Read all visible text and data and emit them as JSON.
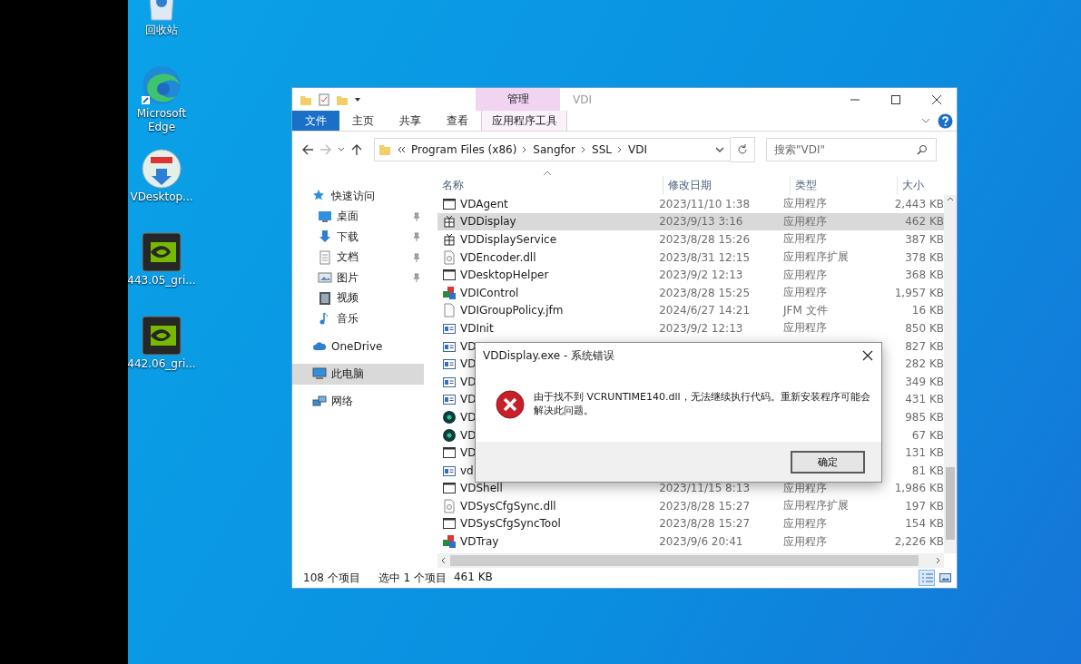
{
  "desktop_icons": [
    {
      "kind": "recycle",
      "label": "回收站"
    },
    {
      "kind": "edge",
      "label": "Microsoft Edge"
    },
    {
      "kind": "installer",
      "label": "VDesktop..."
    },
    {
      "kind": "gpu",
      "label": "443.05_gri..."
    },
    {
      "kind": "gpu",
      "label": "442.06_gri..."
    }
  ],
  "explorer": {
    "title": "VDI",
    "context_tab": "管理",
    "ribbon_tabs": [
      {
        "label": "文件",
        "kind": "file",
        "selected": false
      },
      {
        "label": "主页",
        "kind": "plain",
        "selected": false
      },
      {
        "label": "共享",
        "kind": "plain",
        "selected": false
      },
      {
        "label": "查看",
        "kind": "plain",
        "selected": false
      },
      {
        "label": "应用程序工具",
        "kind": "context",
        "selected": false
      }
    ],
    "breadcrumb": [
      "Program Files (x86)",
      "Sangfor",
      "SSL",
      "VDI"
    ],
    "search": {
      "placeholder": "搜索\"VDI\""
    },
    "nav": [
      {
        "label": "快速访问",
        "kind": "star",
        "pinned": false,
        "selected": false,
        "children": [
          {
            "label": "桌面",
            "kind": "desktop",
            "pinned": true,
            "selected": false
          },
          {
            "label": "下载",
            "kind": "download",
            "pinned": true,
            "selected": false
          },
          {
            "label": "文档",
            "kind": "document",
            "pinned": true,
            "selected": false
          },
          {
            "label": "图片",
            "kind": "pictures",
            "pinned": true,
            "selected": false
          },
          {
            "label": "视频",
            "kind": "video",
            "pinned": false,
            "selected": false
          },
          {
            "label": "音乐",
            "kind": "music",
            "pinned": false,
            "selected": false
          }
        ]
      },
      {
        "label": "OneDrive",
        "kind": "cloud",
        "pinned": false,
        "selected": false
      },
      {
        "label": "此电脑",
        "kind": "pc",
        "pinned": false,
        "selected": true
      },
      {
        "label": "网络",
        "kind": "network",
        "pinned": false,
        "selected": false
      }
    ],
    "columns": [
      "名称",
      "修改日期",
      "类型",
      "大小"
    ],
    "rows": [
      {
        "kind": "window",
        "name": "VDAgent",
        "date": "2023/11/10 1:38",
        "type": "应用程序",
        "size": "2,443 KB",
        "selected": false
      },
      {
        "kind": "gift",
        "name": "VDDisplay",
        "date": "2023/9/13 3:16",
        "type": "应用程序",
        "size": "462 KB",
        "selected": true
      },
      {
        "kind": "gift",
        "name": "VDDisplayService",
        "date": "2023/8/28 15:26",
        "type": "应用程序",
        "size": "387 KB",
        "selected": false
      },
      {
        "kind": "dll",
        "name": "VDEncoder.dll",
        "date": "2023/8/31 12:15",
        "type": "应用程序扩展",
        "size": "378 KB",
        "selected": false
      },
      {
        "kind": "window",
        "name": "VDesktopHelper",
        "date": "2023/9/2 12:13",
        "type": "应用程序",
        "size": "368 KB",
        "selected": false
      },
      {
        "kind": "colored",
        "name": "VDIControl",
        "date": "2023/8/28 15:25",
        "type": "应用程序",
        "size": "1,957 KB",
        "selected": false
      },
      {
        "kind": "file",
        "name": "VDIGroupPolicy.jfm",
        "date": "2024/6/27 14:21",
        "type": "JFM 文件",
        "size": "16 KB",
        "selected": false
      },
      {
        "kind": "form",
        "name": "VDInit",
        "date": "2023/9/2 12:13",
        "type": "应用程序",
        "size": "850 KB",
        "selected": false
      },
      {
        "kind": "form",
        "name": "VD",
        "size": "827 KB",
        "selected": false
      },
      {
        "kind": "form",
        "name": "VD",
        "size": "282 KB",
        "selected": false
      },
      {
        "kind": "form",
        "name": "VD",
        "size": "349 KB",
        "selected": false
      },
      {
        "kind": "form",
        "name": "VD",
        "size": "431 KB",
        "selected": false
      },
      {
        "kind": "green",
        "name": "VD",
        "size": "985 KB",
        "selected": false
      },
      {
        "kind": "green",
        "name": "VD",
        "size": "67 KB",
        "selected": false
      },
      {
        "kind": "window",
        "name": "VD",
        "size": "131 KB",
        "selected": false
      },
      {
        "kind": "form",
        "name": "vd",
        "size": "81 KB",
        "selected": false
      },
      {
        "kind": "window",
        "name": "VDShell",
        "date": "2023/11/15 8:13",
        "type": "应用程序",
        "size": "1,986 KB",
        "selected": false
      },
      {
        "kind": "dll",
        "name": "VDSysCfgSync.dll",
        "date": "2023/8/28 15:27",
        "type": "应用程序扩展",
        "size": "197 KB",
        "selected": false
      },
      {
        "kind": "window",
        "name": "VDSysCfgSyncTool",
        "date": "2023/8/28 15:27",
        "type": "应用程序",
        "size": "154 KB",
        "selected": false
      },
      {
        "kind": "colored",
        "name": "VDTray",
        "date": "2023/9/6 20:41",
        "type": "应用程序",
        "size": "2,226 KB",
        "selected": false
      }
    ],
    "status": {
      "count": "108 个项目",
      "selection": "选中 1 个项目",
      "selection_size": "461 KB"
    },
    "views": [
      {
        "kind": "details",
        "selected": true
      },
      {
        "kind": "large",
        "selected": false
      }
    ]
  },
  "dialog": {
    "title": "VDDisplay.exe - 系统错误",
    "kind": "error",
    "message": "由于找不到 VCRUNTIME140.dll，无法继续执行代码。重新安装程序可能会解决此问题。",
    "button": "确定"
  }
}
